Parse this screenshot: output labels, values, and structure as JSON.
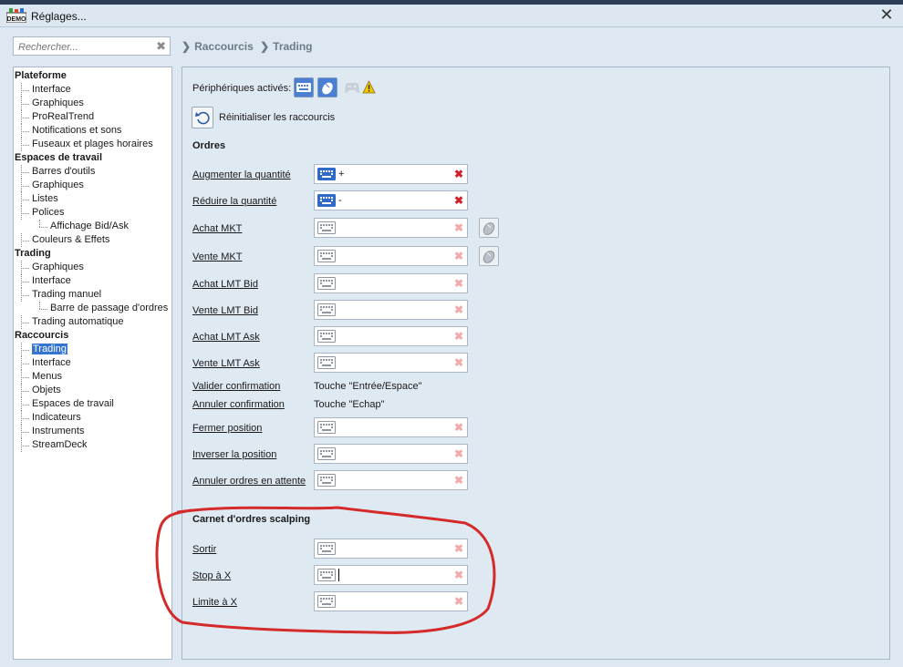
{
  "window": {
    "title": "Réglages..."
  },
  "search": {
    "placeholder": "Rechercher..."
  },
  "breadcrumb": [
    "Raccourcis",
    "Trading"
  ],
  "tree": [
    {
      "type": "cat",
      "label": "Plateforme"
    },
    {
      "type": "item",
      "label": "Interface"
    },
    {
      "type": "item",
      "label": "Graphiques"
    },
    {
      "type": "item",
      "label": "ProRealTrend"
    },
    {
      "type": "item",
      "label": "Notifications et sons"
    },
    {
      "type": "item",
      "label": "Fuseaux et plages horaires"
    },
    {
      "type": "cat",
      "label": "Espaces de travail"
    },
    {
      "type": "item",
      "label": "Barres d'outils"
    },
    {
      "type": "item",
      "label": "Graphiques"
    },
    {
      "type": "item",
      "label": "Listes"
    },
    {
      "type": "item",
      "label": "Polices"
    },
    {
      "type": "sub",
      "label": "Affichage Bid/Ask"
    },
    {
      "type": "item",
      "label": "Couleurs & Effets"
    },
    {
      "type": "cat",
      "label": "Trading"
    },
    {
      "type": "item",
      "label": "Graphiques"
    },
    {
      "type": "item",
      "label": "Interface"
    },
    {
      "type": "item",
      "label": "Trading manuel"
    },
    {
      "type": "sub",
      "label": "Barre de passage d'ordres"
    },
    {
      "type": "item",
      "label": "Trading automatique"
    },
    {
      "type": "cat",
      "label": "Raccourcis"
    },
    {
      "type": "item",
      "label": "Trading",
      "selected": true
    },
    {
      "type": "item",
      "label": "Interface"
    },
    {
      "type": "item",
      "label": "Menus"
    },
    {
      "type": "item",
      "label": "Objets"
    },
    {
      "type": "item",
      "label": "Espaces de travail"
    },
    {
      "type": "item",
      "label": "Indicateurs"
    },
    {
      "type": "item",
      "label": "Instruments"
    },
    {
      "type": "item",
      "label": "StreamDeck"
    }
  ],
  "panel": {
    "peripherals_label": "Périphériques activés:",
    "devices": [
      "keyboard-icon",
      "mouse-icon",
      "gamepad-icon",
      "warning-icon"
    ],
    "reset_label": "Réinitialiser les raccourcis",
    "section_orders": "Ordres",
    "section_scalping": "Carnet d'ordres scalping",
    "shortcuts": [
      {
        "label": "Augmenter la quantité",
        "value": "+",
        "active": true
      },
      {
        "label": "Réduire la quantité",
        "value": "-",
        "active": true
      },
      {
        "label": "Achat MKT",
        "value": "",
        "active": false,
        "mouse": true
      },
      {
        "label": "Vente MKT",
        "value": "",
        "active": false,
        "mouse": true
      },
      {
        "label": "Achat LMT Bid",
        "value": "",
        "active": false
      },
      {
        "label": "Vente LMT Bid",
        "value": "",
        "active": false
      },
      {
        "label": "Achat LMT Ask",
        "value": "",
        "active": false
      },
      {
        "label": "Vente LMT Ask",
        "value": "",
        "active": false
      }
    ],
    "confirm": [
      {
        "label": "Valider confirmation",
        "value": "Touche \"Entrée/Espace\""
      },
      {
        "label": "Annuler confirmation",
        "value": "Touche \"Echap\""
      }
    ],
    "position_shortcuts": [
      {
        "label": "Fermer position",
        "value": ""
      },
      {
        "label": "Inverser la position",
        "value": ""
      },
      {
        "label": "Annuler ordres en attente",
        "value": ""
      }
    ],
    "scalping_shortcuts": [
      {
        "label": "Sortir",
        "value": ""
      },
      {
        "label": "Stop à X",
        "value": "",
        "focused": true
      },
      {
        "label": "Limite à X",
        "value": ""
      }
    ]
  },
  "colors": {
    "accent": "#3476cf",
    "clear_active": "#d0202a",
    "annotation": "#d42a2a"
  }
}
